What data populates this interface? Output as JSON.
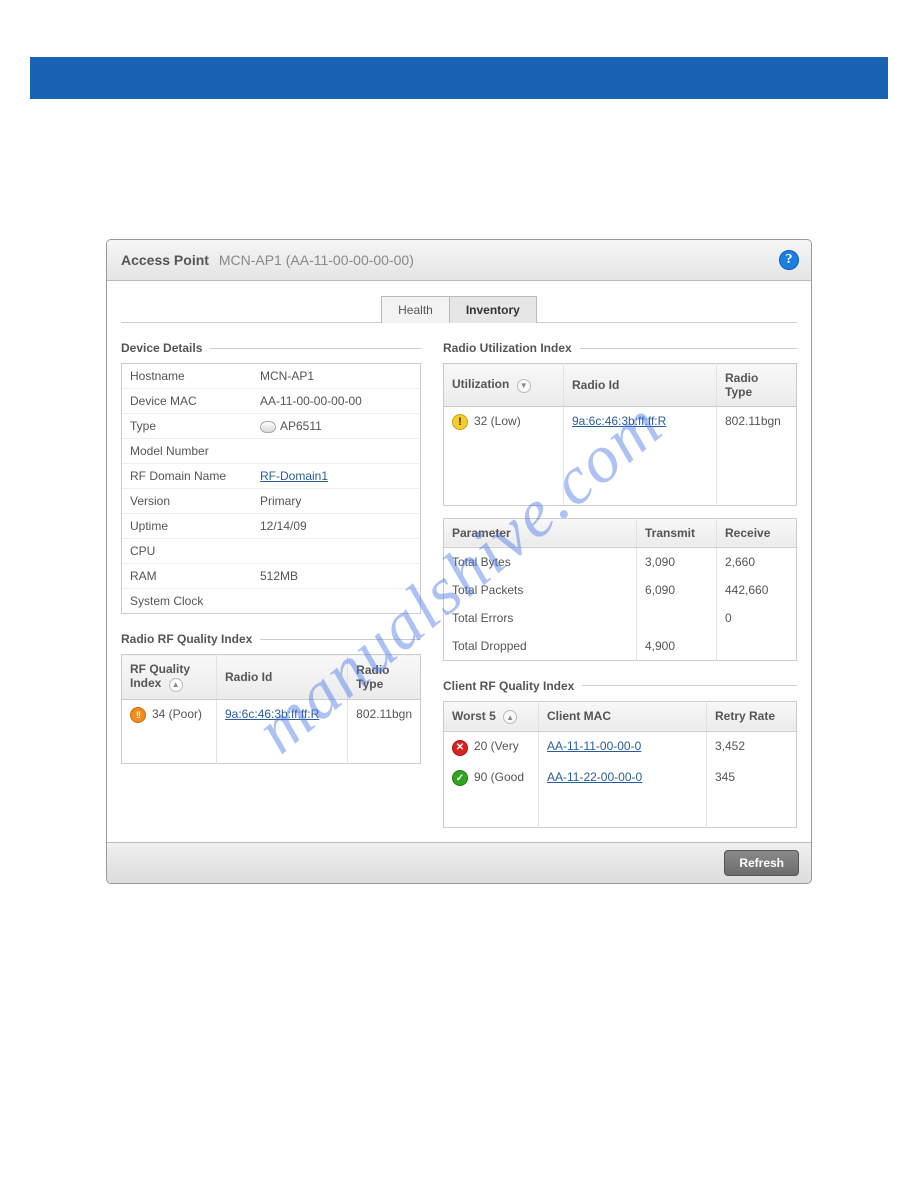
{
  "watermark": "manualshive.com",
  "header": {
    "title_label": "Access Point",
    "title_value": "MCN-AP1 (AA-11-00-00-00-00)"
  },
  "tabs": {
    "health": "Health",
    "inventory": "Inventory"
  },
  "sections": {
    "device_details": "Device Details",
    "radio_rf_quality": "Radio RF Quality Index",
    "radio_util": "Radio Utilization Index",
    "client_rf_quality": "Client RF Quality Index"
  },
  "device": {
    "labels": {
      "hostname": "Hostname",
      "mac": "Device MAC",
      "type": "Type",
      "model": "Model Number",
      "rfdomain": "RF Domain Name",
      "version": "Version",
      "uptime": "Uptime",
      "cpu": "CPU",
      "ram": "RAM",
      "clock": "System Clock"
    },
    "values": {
      "hostname": "MCN-AP1",
      "mac": "AA-11-00-00-00-00",
      "type": "AP6511",
      "model": "",
      "rfdomain": "RF-Domain1",
      "version": "Primary",
      "uptime": "12/14/09",
      "cpu": "",
      "ram": "512MB",
      "clock": ""
    }
  },
  "rf_quality": {
    "cols": {
      "index": "RF Quality Index",
      "radio_id": "Radio Id",
      "radio_type": "Radio Type"
    },
    "rows": [
      {
        "status": "poor",
        "index": "34 (Poor)",
        "radio_id": "9a:6c:46:3b:ff:ff:R",
        "radio_type": "802.11bgn"
      }
    ]
  },
  "radio_util": {
    "cols": {
      "util": "Utilization",
      "radio_id": "Radio Id",
      "radio_type": "Radio Type"
    },
    "rows": [
      {
        "status": "low",
        "util": "32 (Low)",
        "radio_id": "9a:6c:46:3b:ff:ff:R",
        "radio_type": "802.11bgn"
      }
    ]
  },
  "params": {
    "cols": {
      "param": "Parameter",
      "tx": "Transmit",
      "rx": "Receive"
    },
    "rows": [
      {
        "param": "Total Bytes",
        "tx": "3,090",
        "rx": "2,660"
      },
      {
        "param": "Total Packets",
        "tx": "6,090",
        "rx": "442,660"
      },
      {
        "param": "Total Errors",
        "tx": "",
        "rx": "0"
      },
      {
        "param": "Total Dropped",
        "tx": "4,900",
        "rx": ""
      }
    ]
  },
  "client_rf": {
    "cols": {
      "worst5": "Worst 5",
      "mac": "Client MAC",
      "retry": "Retry Rate"
    },
    "rows": [
      {
        "status": "bad",
        "score": "20 (Very",
        "mac": "AA-11-11-00-00-0",
        "retry": "3,452"
      },
      {
        "status": "good",
        "score": "90 (Good",
        "mac": "AA-11-22-00-00-0",
        "retry": "345"
      }
    ]
  },
  "footer": {
    "refresh": "Refresh"
  }
}
